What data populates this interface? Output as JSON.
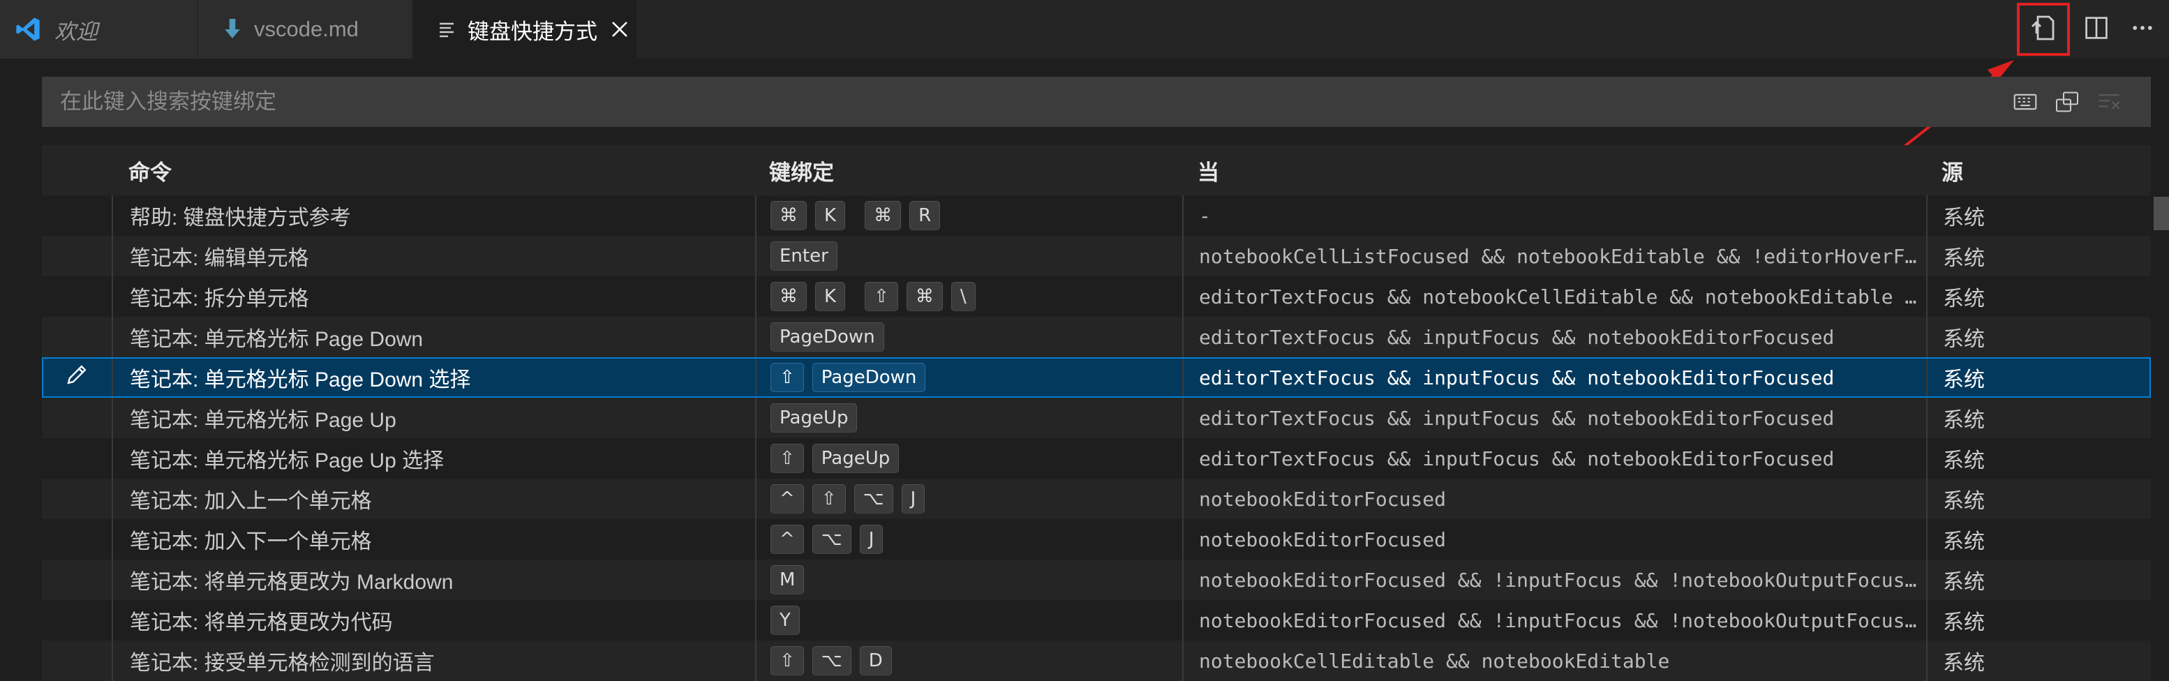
{
  "tabs": [
    {
      "label": "欢迎",
      "icon": "vscode-logo-icon"
    },
    {
      "label": "vscode.md",
      "icon": "markdown-arrow-icon"
    },
    {
      "label": "键盘快捷方式",
      "icon": "keyboard-doc-icon",
      "active": true
    }
  ],
  "search": {
    "placeholder": "在此键入搜索按键绑定"
  },
  "table": {
    "headers": {
      "command": "命令",
      "keybinding": "键绑定",
      "when": "当",
      "source": "源"
    },
    "rows": [
      {
        "command": "帮助: 键盘快捷方式参考",
        "keys": [
          [
            "⌘",
            "K"
          ],
          [
            "⌘",
            "R"
          ]
        ],
        "when": "-",
        "source": "系统"
      },
      {
        "command": "笔记本: 编辑单元格",
        "keys": [
          [
            "Enter"
          ]
        ],
        "when": "notebookCellListFocused && notebookEditable && !editorHoverFocused",
        "source": "系统"
      },
      {
        "command": "笔记本: 拆分单元格",
        "keys": [
          [
            "⌘",
            "K"
          ],
          [
            "⇧",
            "⌘",
            "\\"
          ]
        ],
        "when": "editorTextFocus && notebookCellEditable && notebookEditable && notebookEditorFocused",
        "source": "系统"
      },
      {
        "command": "笔记本: 单元格光标 Page Down",
        "keys": [
          [
            "PageDown"
          ]
        ],
        "when": "editorTextFocus && inputFocus && notebookEditorFocused",
        "source": "系统"
      },
      {
        "command": "笔记本: 单元格光标 Page Down 选择",
        "keys": [
          [
            "⇧",
            "PageDown"
          ]
        ],
        "when": "editorTextFocus && inputFocus && notebookEditorFocused",
        "source": "系统",
        "selected": true
      },
      {
        "command": "笔记本: 单元格光标 Page Up",
        "keys": [
          [
            "PageUp"
          ]
        ],
        "when": "editorTextFocus && inputFocus && notebookEditorFocused",
        "source": "系统"
      },
      {
        "command": "笔记本: 单元格光标 Page Up 选择",
        "keys": [
          [
            "⇧",
            "PageUp"
          ]
        ],
        "when": "editorTextFocus && inputFocus && notebookEditorFocused",
        "source": "系统"
      },
      {
        "command": "笔记本: 加入上一个单元格",
        "keys": [
          [
            "^",
            "⇧",
            "⌥",
            "J"
          ]
        ],
        "when": "notebookEditorFocused",
        "source": "系统"
      },
      {
        "command": "笔记本: 加入下一个单元格",
        "keys": [
          [
            "^",
            "⌥",
            "J"
          ]
        ],
        "when": "notebookEditorFocused",
        "source": "系统"
      },
      {
        "command": "笔记本: 将单元格更改为 Markdown",
        "keys": [
          [
            "M"
          ]
        ],
        "when": "notebookEditorFocused && !inputFocus && !notebookOutputFocused",
        "source": "系统"
      },
      {
        "command": "笔记本: 将单元格更改为代码",
        "keys": [
          [
            "Y"
          ]
        ],
        "when": "notebookEditorFocused && !inputFocus && !notebookOutputFocused",
        "source": "系统"
      },
      {
        "command": "笔记本: 接受单元格检测到的语言",
        "keys": [
          [
            "⇧",
            "⌥",
            "D"
          ]
        ],
        "when": "notebookCellEditable && notebookEditable",
        "source": "系统"
      }
    ]
  },
  "colors": {
    "accent": "#007fd4",
    "selected_row": "#04395e",
    "highlight_box": "#e02020"
  }
}
